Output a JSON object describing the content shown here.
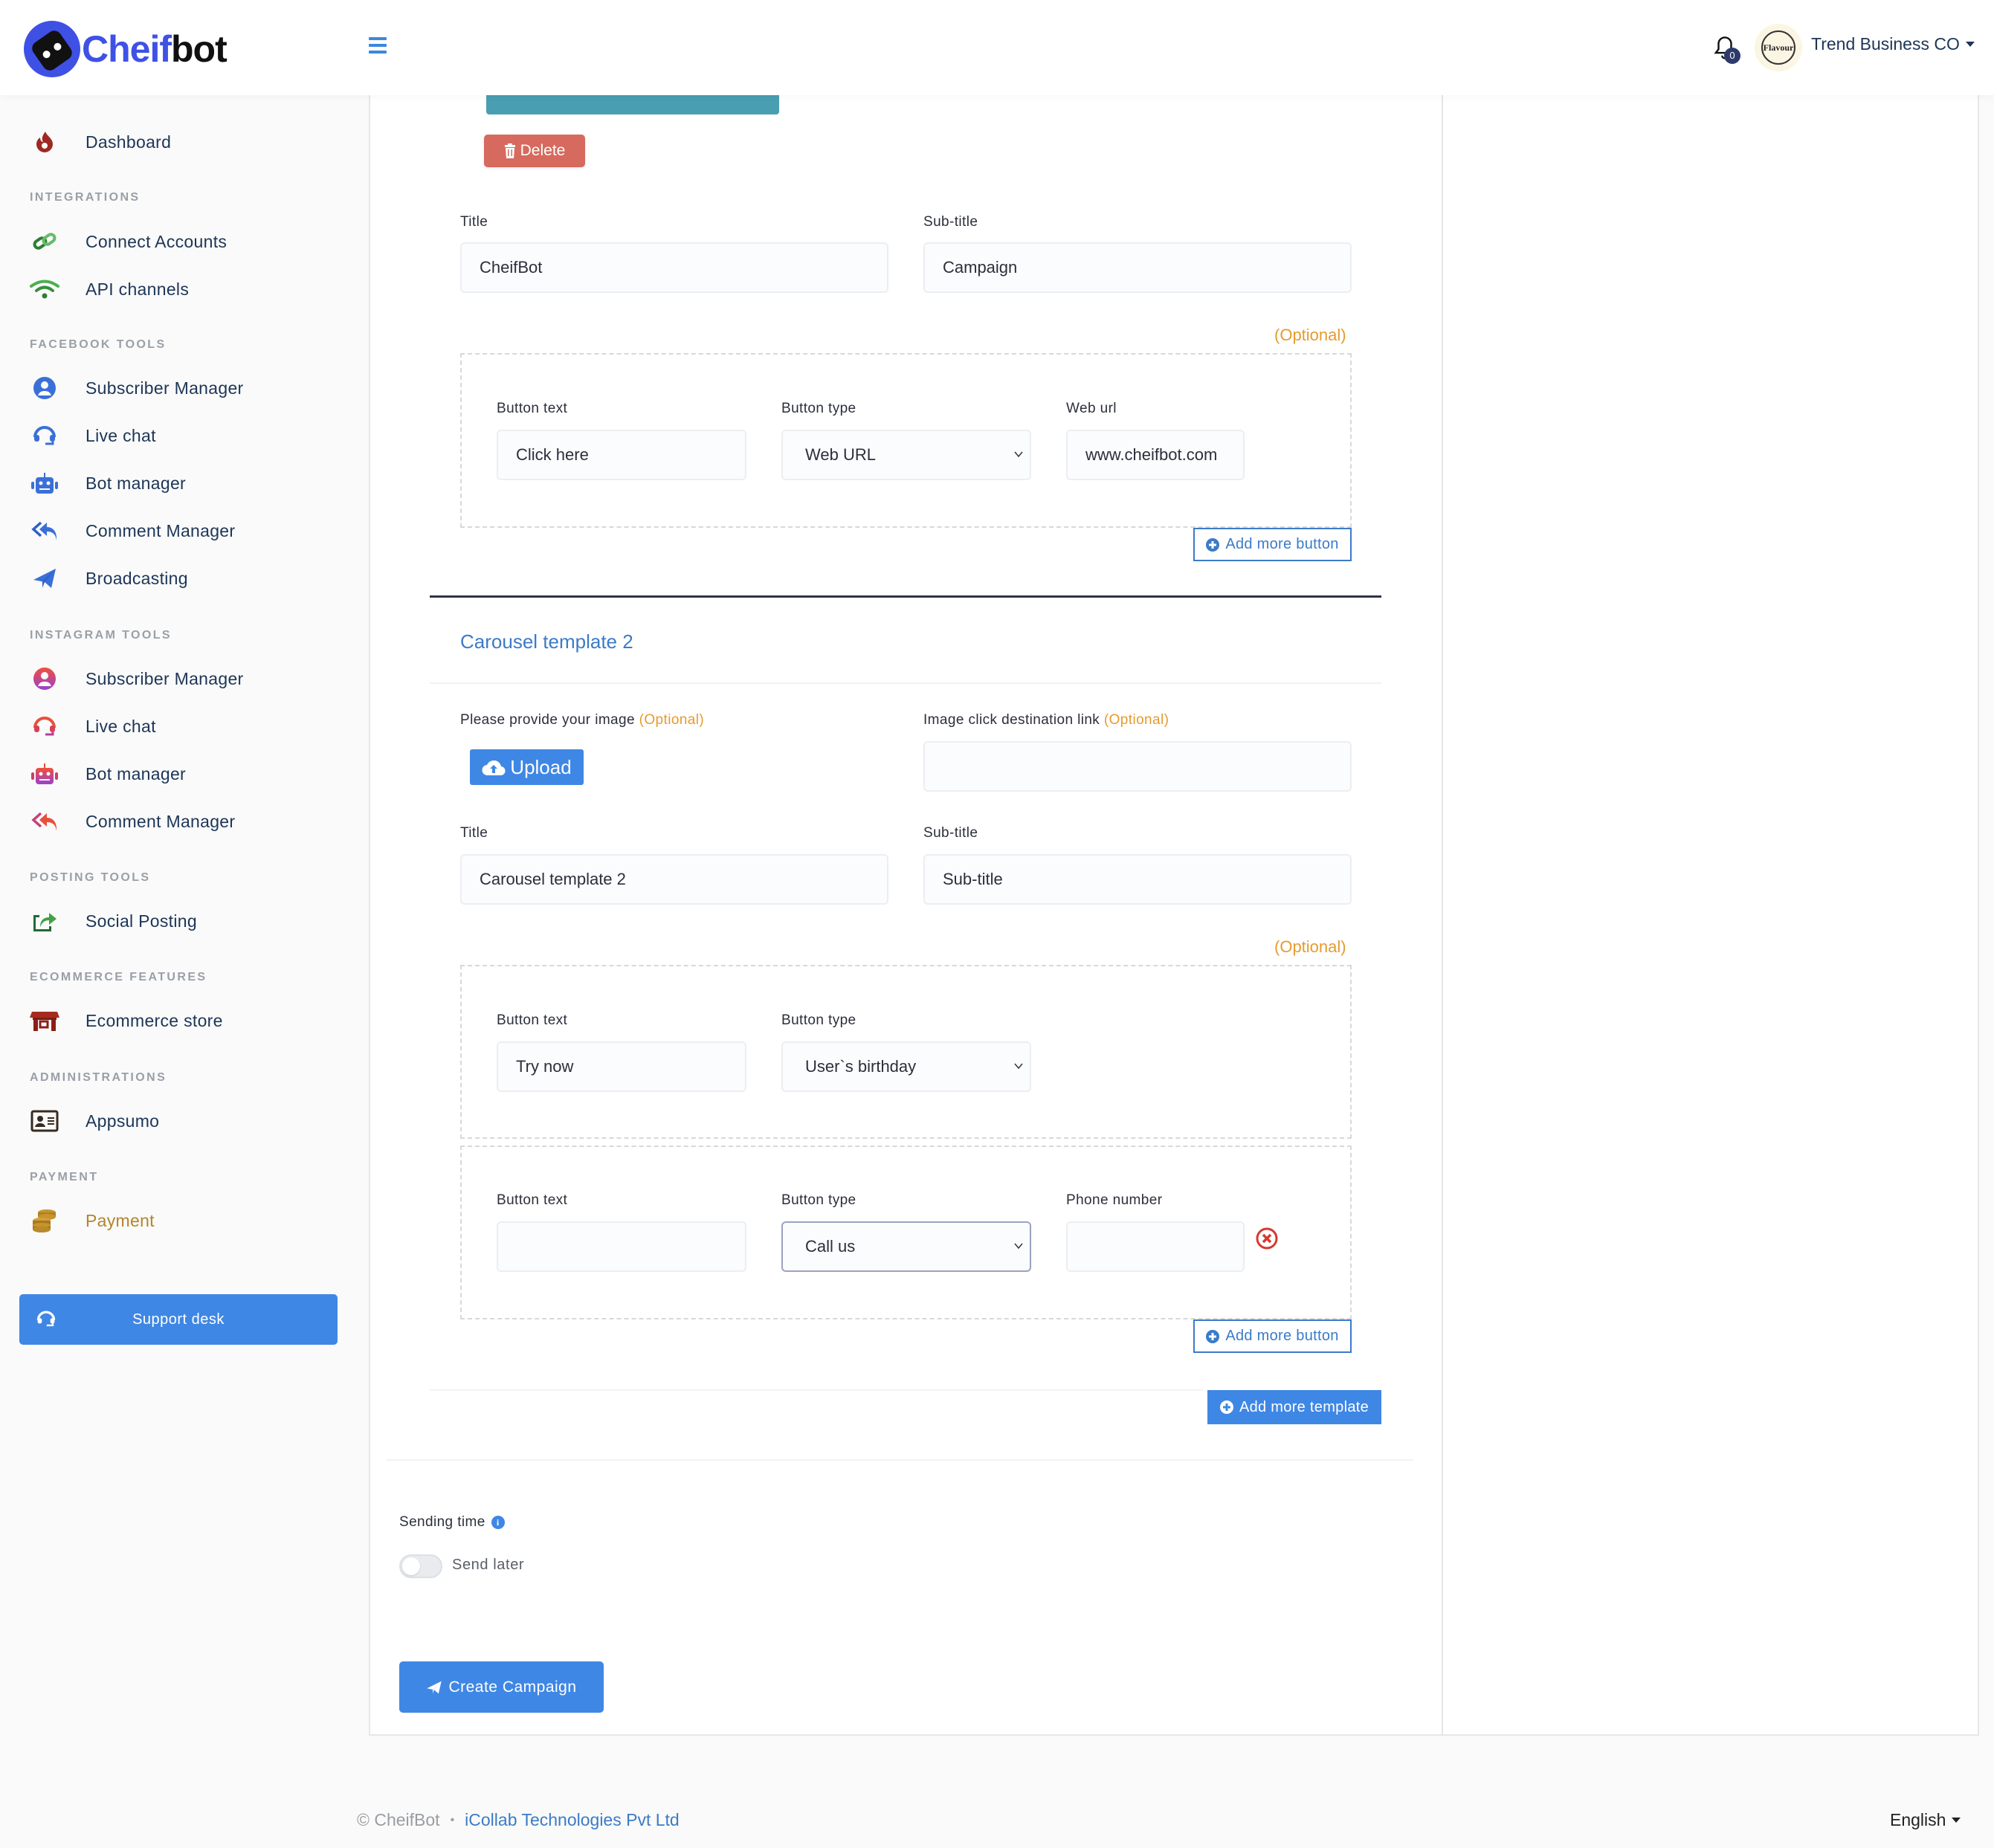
{
  "app": {
    "brand_a": "Cheif",
    "brand_b": "bot"
  },
  "header": {
    "notification_count": "0",
    "avatar_text": "Flavour",
    "user_name": "Trend Business CO"
  },
  "sidebar": {
    "dashboard": "Dashboard",
    "sections": {
      "integrations": "INTEGRATIONS",
      "facebook": "FACEBOOK TOOLS",
      "instagram": "INSTAGRAM TOOLS",
      "posting": "POSTING TOOLS",
      "ecommerce": "ECOMMERCE FEATURES",
      "admin": "ADMINISTRATIONS",
      "payment": "PAYMENT"
    },
    "items": {
      "connect_accounts": "Connect Accounts",
      "api_channels": "API channels",
      "fb_subscriber": "Subscriber Manager",
      "fb_livechat": "Live chat",
      "fb_bot": "Bot manager",
      "fb_comment": "Comment Manager",
      "fb_broadcast": "Broadcasting",
      "ig_subscriber": "Subscriber Manager",
      "ig_livechat": "Live chat",
      "ig_bot": "Bot manager",
      "ig_comment": "Comment Manager",
      "social_posting": "Social Posting",
      "ecommerce_store": "Ecommerce store",
      "appsumo": "Appsumo",
      "payment": "Payment"
    },
    "support_desk": "Support desk"
  },
  "template1": {
    "delete_label": "Delete",
    "title_label": "Title",
    "title_value": "CheifBot",
    "subtitle_label": "Sub-title",
    "subtitle_value": "Campaign",
    "optional": "(Optional)",
    "buttons": [
      {
        "text_label": "Button text",
        "text_value": "Click here",
        "type_label": "Button type",
        "type_value": "Web URL",
        "extra_label": "Web url",
        "extra_value": "www.cheifbot.com"
      }
    ],
    "add_more_button": "Add more button"
  },
  "template2": {
    "heading": "Carousel template 2",
    "image_label": "Please provide your image",
    "image_optional": "(Optional)",
    "upload_label": "Upload",
    "link_label": "Image click destination link",
    "link_optional": "(Optional)",
    "link_value": "",
    "title_label": "Title",
    "title_value": "Carousel template 2",
    "subtitle_label": "Sub-title",
    "subtitle_value": "Sub-title",
    "optional": "(Optional)",
    "buttons": [
      {
        "text_label": "Button text",
        "text_value": "Try now",
        "type_label": "Button type",
        "type_value": "User`s birthday"
      },
      {
        "text_label": "Button text",
        "text_value": "",
        "type_label": "Button type",
        "type_value": "Call us",
        "extra_label": "Phone number",
        "extra_value": ""
      }
    ],
    "add_more_button": "Add more button"
  },
  "add_more_template": "Add more template",
  "sending": {
    "label": "Sending time",
    "info": "i",
    "toggle_label": "Send later",
    "toggle_on": false
  },
  "create_campaign": "Create Campaign",
  "footer": {
    "copyright": "© CheifBot",
    "separator": "•",
    "company": "iCollab Technologies Pvt Ltd",
    "language": "English"
  },
  "colors": {
    "primary": "#3f87e5",
    "danger": "#d66a5e",
    "optional": "#e59b2e",
    "teal": "#4a9eb1",
    "brand": "#3f51e5"
  }
}
